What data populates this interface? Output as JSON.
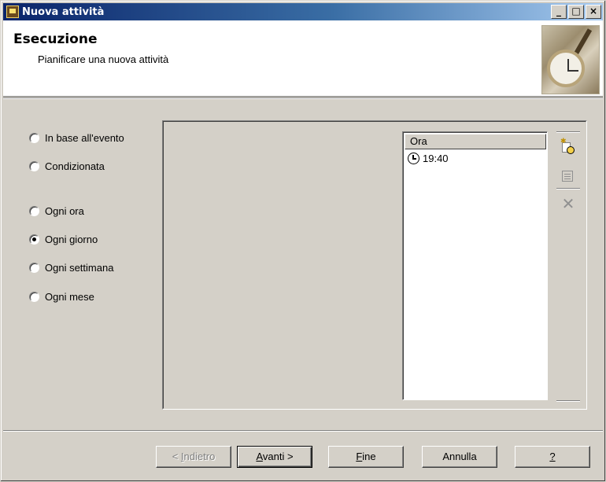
{
  "window": {
    "title": "Nuova attività",
    "controls": {
      "minimize": "_",
      "maximize": "□",
      "close": "×"
    }
  },
  "header": {
    "title": "Esecuzione",
    "subtitle": "Pianificare una nuova attività"
  },
  "schedule_options": [
    {
      "label": "In base all'evento",
      "checked": false
    },
    {
      "label": "Condizionata",
      "checked": false
    },
    {
      "label": "Ogni ora",
      "checked": false
    },
    {
      "label": "Ogni giorno",
      "checked": true
    },
    {
      "label": "Ogni settimana",
      "checked": false
    },
    {
      "label": "Ogni mese",
      "checked": false
    }
  ],
  "time_list": {
    "column_header": "Ora",
    "rows": [
      {
        "time": "19:40",
        "icon": "clock-icon"
      }
    ]
  },
  "toolbar": {
    "new_icon": "new-time-icon",
    "properties_icon": "properties-icon",
    "delete_icon": "delete-icon",
    "delete_glyph": "✕"
  },
  "buttons": {
    "back": {
      "accel": "I",
      "rest": "ndietro",
      "prefix": "< "
    },
    "next": {
      "accel": "A",
      "rest": "vanti",
      "suffix": " >"
    },
    "finish": {
      "accel": "F",
      "rest": "ine"
    },
    "cancel": "Annulla",
    "help": "?"
  }
}
